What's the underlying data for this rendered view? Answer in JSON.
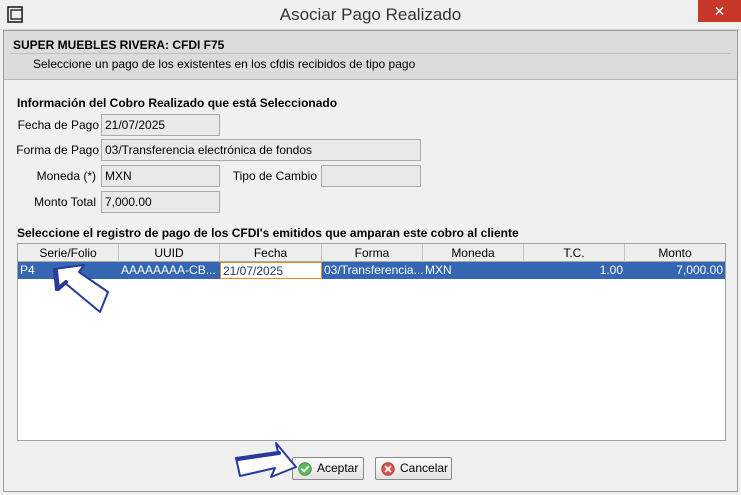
{
  "window": {
    "title": "Asociar Pago Realizado",
    "close_glyph": "✕",
    "app_icon": "app-window-icon",
    "close_color": "#c7382b"
  },
  "header": {
    "title": "SUPER MUEBLES RIVERA: CFDI F75",
    "subtitle": "Seleccione un pago de los existentes en los cfdis recibidos de tipo pago"
  },
  "cobro": {
    "section_title": "Información del Cobro Realizado que está Seleccionado",
    "fecha_label": "Fecha de Pago",
    "fecha_value": "21/07/2025",
    "forma_label": "Forma de Pago",
    "forma_value": "03/Transferencia electrónica de fondos",
    "moneda_label": "Moneda (*)",
    "moneda_value": "MXN",
    "tipo_cambio_label": "Tipo de Cambio",
    "tipo_cambio_value": "",
    "monto_label": "Monto Total",
    "monto_value": "7,000.00"
  },
  "registros": {
    "section_title": "Seleccione el registro de pago de los CFDI's emitidos que amparan este cobro al cliente",
    "columns": [
      "Serie/Folio",
      "UUID",
      "Fecha",
      "Forma",
      "Moneda",
      "T.C.",
      "Monto"
    ],
    "rows": [
      {
        "serie_folio": "P4",
        "uuid": "AAAAAAAA-CB...",
        "fecha": "21/07/2025",
        "forma": "03/Transferencia...",
        "moneda": "MXN",
        "tc": "1.00",
        "monto": "7,000.00"
      }
    ],
    "selected_color": "#3566b1"
  },
  "buttons": {
    "accept_label": "Aceptar",
    "accept_icon": "check-circle-icon",
    "cancel_label": "Cancelar",
    "cancel_icon": "cancel-circle-icon"
  },
  "annotations": {
    "arrow_color": "#2a3a9a"
  }
}
